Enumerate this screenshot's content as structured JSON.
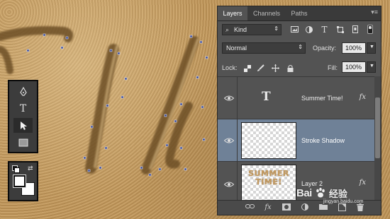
{
  "panel": {
    "tabs": [
      {
        "label": "Layers",
        "active": true
      },
      {
        "label": "Channels",
        "active": false
      },
      {
        "label": "Paths",
        "active": false
      }
    ],
    "filter": {
      "kind": "Kind",
      "icons": [
        "image-filter-icon",
        "adjustment-filter-icon",
        "type-filter-icon",
        "shape-filter-icon",
        "smart-object-filter-icon",
        "filter-toggle-icon"
      ]
    },
    "blend_mode": "Normal",
    "opacity_label": "Opacity:",
    "opacity_value": "100%",
    "lock_label": "Lock:",
    "lock_icons": [
      "lock-transparent-icon",
      "lock-image-icon",
      "lock-position-icon",
      "lock-all-icon"
    ],
    "fill_label": "Fill:",
    "fill_value": "100%",
    "layers": [
      {
        "name": "Summer Time!",
        "type": "text",
        "fx": "fx",
        "selected": false,
        "visible": true
      },
      {
        "name": "Stroke Shadow",
        "type": "raster",
        "fx": "",
        "selected": true,
        "visible": true
      },
      {
        "name": "Layer 2",
        "type": "raster",
        "fx": "fx",
        "selected": false,
        "visible": true,
        "thumb_text": [
          "SUMMER",
          "TIME!"
        ]
      }
    ],
    "bottom_icons": [
      "link-layers-icon",
      "fx-icon",
      "mask-icon",
      "adjustment-icon",
      "group-icon",
      "new-layer-icon",
      "trash-icon"
    ],
    "fx_symbol": "fx"
  },
  "tools": {
    "items": [
      {
        "name": "pen-tool-icon",
        "active": false
      },
      {
        "name": "type-tool-icon",
        "label": "T",
        "active": false
      },
      {
        "name": "path-selection-tool-icon",
        "active": true
      },
      {
        "name": "rectangle-tool-icon",
        "active": false
      }
    ]
  },
  "colors": {
    "foreground": "#ffffff",
    "background": "#ffffff"
  },
  "canvas": {
    "sand_color": "#bd965e",
    "stroke_color": "#7a5a2e"
  },
  "watermark": {
    "text": "Bai",
    "cn": "经验",
    "url": "jingyan.baidu.com"
  }
}
